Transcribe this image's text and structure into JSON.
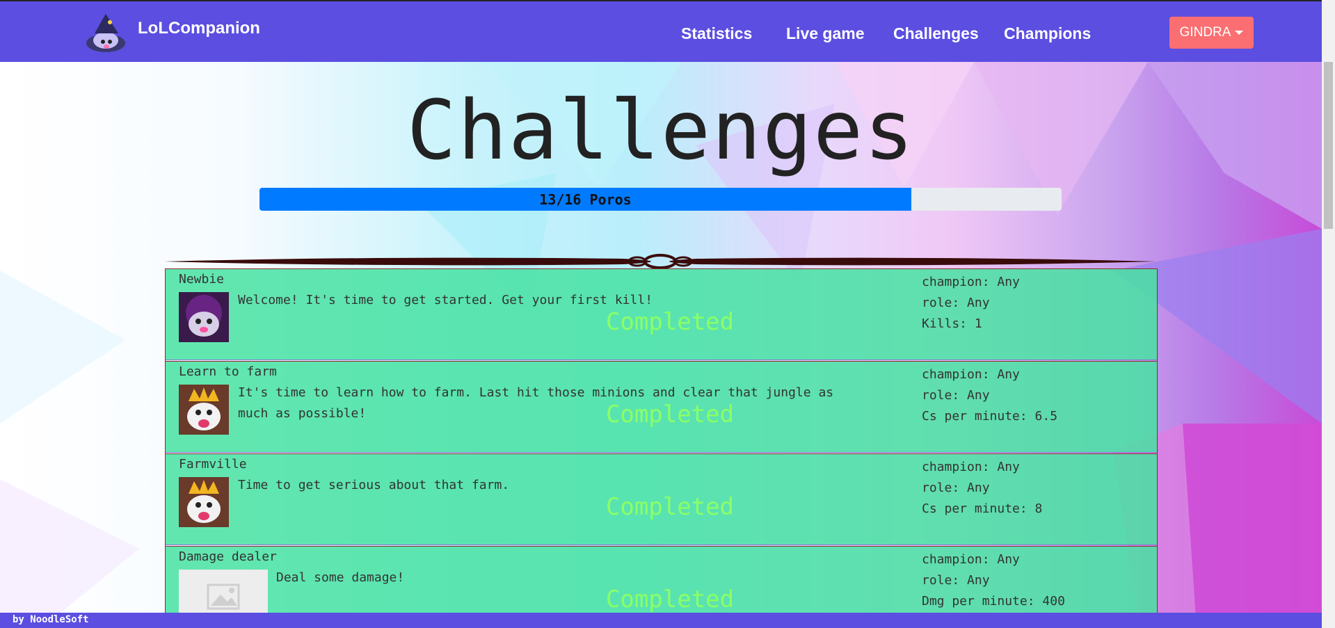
{
  "app": {
    "brand_name": "LoLCompanion",
    "nav": [
      "Statistics",
      "Live game",
      "Challenges",
      "Champions"
    ],
    "user_menu_label": "GINDRA"
  },
  "page": {
    "title": "Challenges",
    "progress": {
      "label": "13/16 Poros",
      "completed": 13,
      "total": 16
    }
  },
  "challenges": [
    {
      "name": "Newbie",
      "description": "Welcome! It's time to get started. Get your first kill!",
      "status": "Completed",
      "champion": "champion: Any",
      "role": "role: Any",
      "goal": "Kills: 1",
      "image": "dark-poro"
    },
    {
      "name": "Learn to farm",
      "description": "It's time to learn how to farm. Last hit those minions and clear that jungle as much as possible!",
      "status": "Completed",
      "champion": "champion: Any",
      "role": "role: Any",
      "goal": "Cs per minute: 6.5",
      "image": "king-poro"
    },
    {
      "name": "Farmville",
      "description": "Time to get serious about that farm.",
      "status": "Completed",
      "champion": "champion: Any",
      "role": "role: Any",
      "goal": "Cs per minute: 8",
      "image": "king-poro"
    },
    {
      "name": "Damage dealer",
      "description": "Deal some damage!",
      "status": "Completed",
      "champion": "champion: Any",
      "role": "role: Any",
      "goal": "Dmg per minute: 400",
      "image": "placeholder-image"
    }
  ],
  "footer": {
    "text": "by NoodleSoft"
  },
  "colors": {
    "navbar": "#5b4ee0",
    "user_button": "#fb6f72",
    "progress_fill": "#007bff",
    "card": "#46e2a2",
    "completed_text": "#8cff66"
  }
}
